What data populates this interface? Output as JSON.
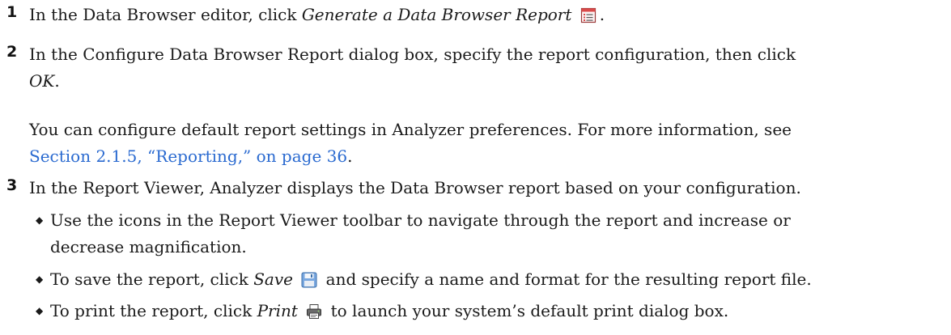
{
  "steps": [
    {
      "number": "1",
      "pre": "In the Data Browser editor, click ",
      "em": "Generate a Data Browser Report",
      "post": ".",
      "icon": "report-icon"
    },
    {
      "number": "2",
      "line1": "In the Configure Data Browser Report dialog box, specify the report configuration, then click",
      "line2_em": "OK",
      "line2_post": ".",
      "note_line1": "You can configure default report settings in Analyzer preferences. For more information, see",
      "note_link": "Section 2.1.5, “Reporting,” on page 36",
      "note_post": "."
    },
    {
      "number": "3",
      "text": "In the Report Viewer, Analyzer displays the Data Browser report based on your configuration.",
      "bullets": [
        {
          "line1": "Use the icons in the Report Viewer toolbar to navigate through the report and increase or",
          "line2": "decrease magnification."
        },
        {
          "pre": "To save the report, click ",
          "em": "Save",
          "post": " and specify a name and format for the resulting report file.",
          "icon": "save-icon"
        },
        {
          "pre": "To print the report, click ",
          "em": "Print",
          "post": " to launch your system’s default print dialog box.",
          "icon": "print-icon"
        }
      ]
    }
  ],
  "colors": {
    "text": "#1a1a1a",
    "link": "#2a6ad0"
  }
}
